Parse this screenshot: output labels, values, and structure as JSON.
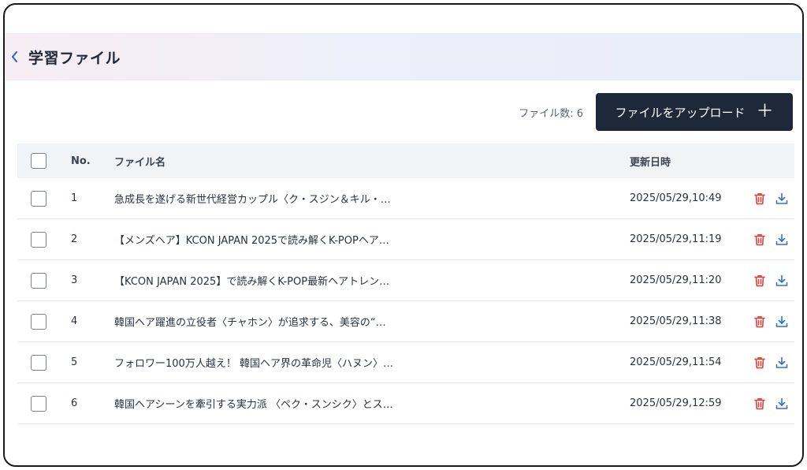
{
  "header": {
    "title": "学習ファイル"
  },
  "toolbar": {
    "file_count": "ファイル数: 6",
    "upload_label": "ファイルをアップロード",
    "upload_icon": "＋"
  },
  "table": {
    "columns": {
      "no": "No.",
      "name": "ファイル名",
      "updated": "更新日時"
    },
    "rows": [
      {
        "no": "1",
        "name": "急成長を遂げる新世代経営カップル〈ク・スジン＆キル・…",
        "updated": "2025/05/29,10:49"
      },
      {
        "no": "2",
        "name": "【メンズヘア】KCON JAPAN 2025で読み解くK-POPヘア…",
        "updated": "2025/05/29,11:19"
      },
      {
        "no": "3",
        "name": "【KCON JAPAN 2025】で読み解くK-POP最新ヘアトレン…",
        "updated": "2025/05/29,11:20"
      },
      {
        "no": "4",
        "name": "韓国ヘア躍進の立役者〈チャホン〉が追求する、美容の“…",
        "updated": "2025/05/29,11:38"
      },
      {
        "no": "5",
        "name": "フォロワー100万人越え！ 韓国ヘア界の革命児〈ハヌン〉…",
        "updated": "2025/05/29,11:54"
      },
      {
        "no": "6",
        "name": "韓国ヘアシーンを牽引する実力派 〈ペク・スンシク〉とス…",
        "updated": "2025/05/29,12:59"
      }
    ]
  },
  "colors": {
    "accent": "#2f6fd6",
    "danger": "#e0403a",
    "dark": "#1d2838"
  },
  "icons": {
    "back": "chevron-left-icon",
    "delete": "trash-icon",
    "download": "download-icon"
  }
}
